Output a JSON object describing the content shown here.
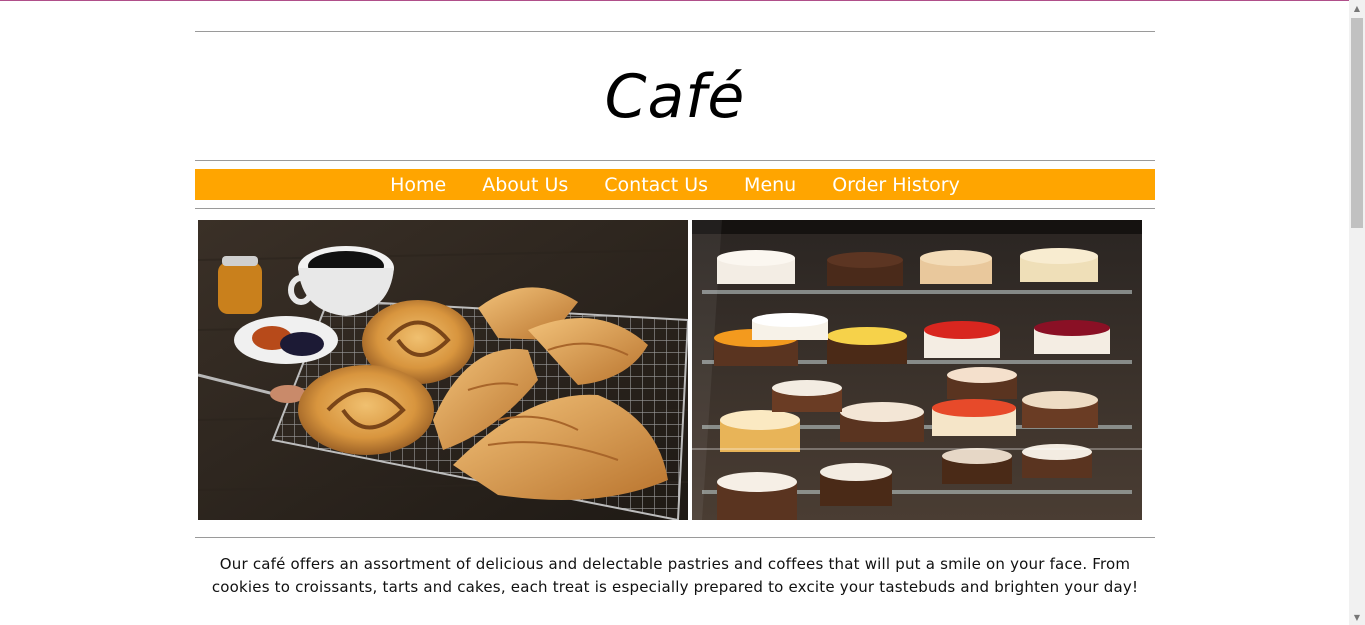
{
  "header": {
    "title": "Café"
  },
  "nav": {
    "items": [
      {
        "label": "Home"
      },
      {
        "label": "About Us"
      },
      {
        "label": "Contact Us"
      },
      {
        "label": "Menu"
      },
      {
        "label": "Order History"
      }
    ]
  },
  "main": {
    "intro": "Our café offers an assortment of delicious and delectable pastries and coffees that will put a smile on your face. From cookies to croissants, tarts and cakes, each treat is especially prepared to excite your tastebuds and brighten your day!"
  },
  "colors": {
    "nav_bg": "#ffa500",
    "nav_text": "#ffffff",
    "rule": "#9a9a9a"
  },
  "icons": {
    "scroll_up": "arrow-up-icon",
    "scroll_down": "arrow-down-icon"
  }
}
